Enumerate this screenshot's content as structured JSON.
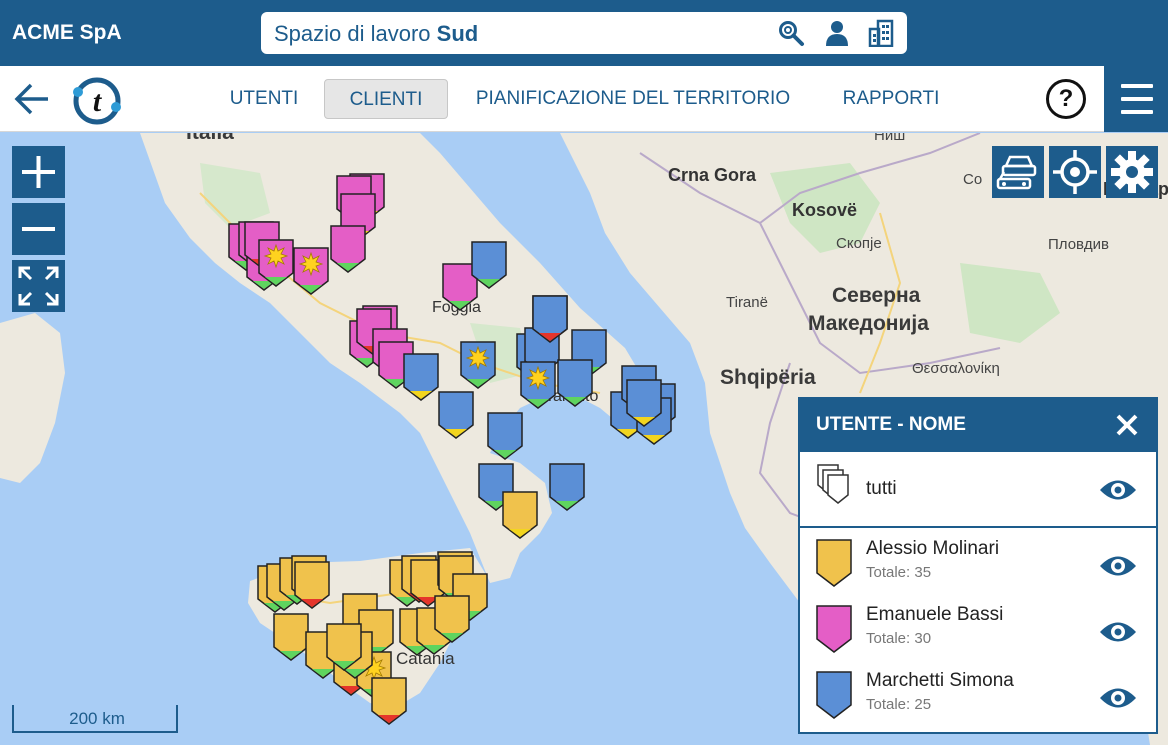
{
  "header": {
    "company": "ACME SpA",
    "workspace_prefix": "Spazio di lavoro",
    "workspace_name": "Sud"
  },
  "nav": {
    "tabs": [
      {
        "label": "UTENTI",
        "active": false
      },
      {
        "label": "CLIENTI",
        "active": true
      },
      {
        "label": "PIANIFICAZIONE DEL TERRITORIO",
        "active": false
      },
      {
        "label": "RAPPORTI",
        "active": false
      }
    ],
    "help_label": "?"
  },
  "map": {
    "labels": {
      "italia": "Italia",
      "foggia": "Foggia",
      "taranto": "Taranto",
      "catania": "Catania",
      "crna_gora": "Crna Gora",
      "kosove": "Kosovë",
      "skopje": "Скопје",
      "tirane": "Tiranë",
      "severna": "Северна",
      "makedonija": "Македонија",
      "shqiperia": "Shqipëria",
      "thessaloniki": "Θεσσαλονίκη",
      "plovdiv": "Пловдив",
      "nis": "Ниш",
      "sofia": "Со",
      "balgaria": "България"
    },
    "scale_label": "200 km",
    "colors": {
      "sea": "#a9cdf5",
      "land": "#ede9df",
      "accent": "#1d5c8c",
      "yellow": "#f0c24c",
      "pink": "#e45ec6",
      "blue": "#5b8fd6",
      "green_tip": "#5fd45f",
      "red_tip": "#e5352b",
      "yellow_tip": "#f3d51e"
    }
  },
  "legend": {
    "title": "UTENTE - NOME",
    "all_label": "tutti",
    "users": [
      {
        "name": "Alessio Molinari",
        "total": "Totale: 35",
        "color": "#f0c24c"
      },
      {
        "name": "Emanuele Bassi",
        "total": "Totale: 30",
        "color": "#e45ec6"
      },
      {
        "name": "Marchetti Simona",
        "total": "Totale: 25",
        "color": "#5b8fd6"
      }
    ]
  }
}
